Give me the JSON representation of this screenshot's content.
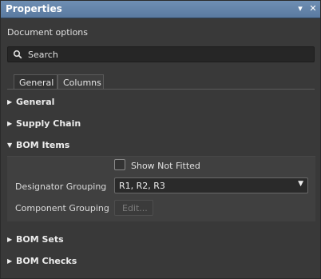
{
  "panel": {
    "title": "Properties",
    "pin_glyph": "▾",
    "close_glyph": "✕",
    "document_options": "Document options",
    "search_placeholder": "Search"
  },
  "tabs": [
    {
      "label": "General",
      "active": true
    },
    {
      "label": "Columns",
      "active": false
    }
  ],
  "sections": {
    "general": {
      "label": "General",
      "expanded": false
    },
    "supply_chain": {
      "label": "Supply Chain",
      "expanded": false
    },
    "bom_items": {
      "label": "BOM Items",
      "expanded": true
    },
    "bom_sets": {
      "label": "BOM Sets",
      "expanded": false
    },
    "bom_checks": {
      "label": "BOM Checks",
      "expanded": false
    }
  },
  "bom_items": {
    "show_not_fitted_label": "Show Not Fitted",
    "show_not_fitted_checked": false,
    "designator_grouping_label": "Designator Grouping",
    "designator_grouping_value": "R1, R2, R3",
    "component_grouping_label": "Component Grouping",
    "edit_button_label": "Edit..."
  },
  "glyphs": {
    "collapsed_caret": "▶",
    "expanded_caret": "▼",
    "dropdown_arrow": "▼"
  },
  "colors": {
    "titlebar": "#5f80a6",
    "panel_bg": "#393939",
    "text": "#d8d8d8"
  }
}
